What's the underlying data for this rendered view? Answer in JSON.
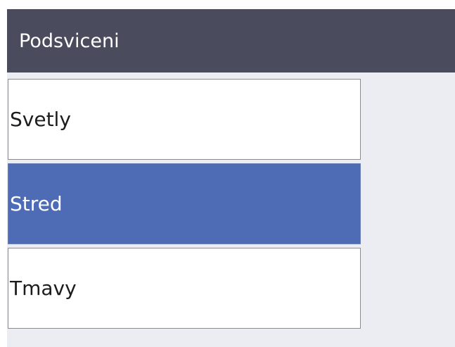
{
  "header": {
    "title": "Podsviceni"
  },
  "menu": {
    "items": [
      {
        "label": "Svetly",
        "selected": false
      },
      {
        "label": "Stred",
        "selected": true
      },
      {
        "label": "Tmavy",
        "selected": false
      }
    ]
  },
  "colors": {
    "header_bg": "#4a4b5c",
    "background": "#ecedf2",
    "selected_bg": "#4d6cb5",
    "item_bg": "#ffffff"
  }
}
